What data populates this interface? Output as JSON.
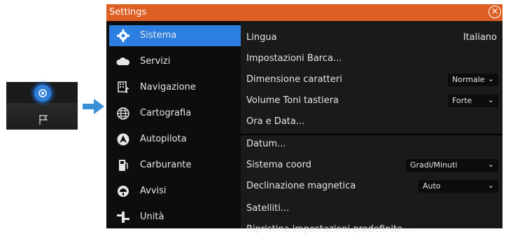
{
  "window": {
    "title": "Settings"
  },
  "sidebar": {
    "items": [
      {
        "label": "Sistema",
        "icon": "gear-icon"
      },
      {
        "label": "Servizi",
        "icon": "cloud-icon"
      },
      {
        "label": "Navigazione",
        "icon": "navigation-icon"
      },
      {
        "label": "Cartografia",
        "icon": "globe-icon"
      },
      {
        "label": "Autopilota",
        "icon": "autopilot-icon"
      },
      {
        "label": "Carburante",
        "icon": "fuel-pump-icon"
      },
      {
        "label": "Avvisi",
        "icon": "alarm-icon"
      },
      {
        "label": "Unità",
        "icon": "units-icon"
      }
    ]
  },
  "settings": {
    "lingua": {
      "label": "Lingua",
      "value": "Italiano"
    },
    "impostazioni_barca": {
      "label": "Impostazioni Barca..."
    },
    "dimensione_caratteri": {
      "label": "Dimensione caratteri",
      "value": "Normale"
    },
    "volume_toni": {
      "label": "Volume Toni tastiera",
      "value": "Forte"
    },
    "ora_data": {
      "label": "Ora e Data..."
    },
    "datum": {
      "label": "Datum..."
    },
    "sistema_coord": {
      "label": "Sistema coord",
      "value": "Gradi/Minuti"
    },
    "declinazione": {
      "label": "Declinazione magnetica",
      "value": "Auto"
    },
    "satelliti": {
      "label": "Satelliti..."
    },
    "ripristina": {
      "label": "Ripristina impostazioni predefinite..."
    }
  },
  "colors": {
    "accent": "#2c7fe0",
    "titlebar": "#dd5f24",
    "arrow": "#3a8fd6"
  }
}
